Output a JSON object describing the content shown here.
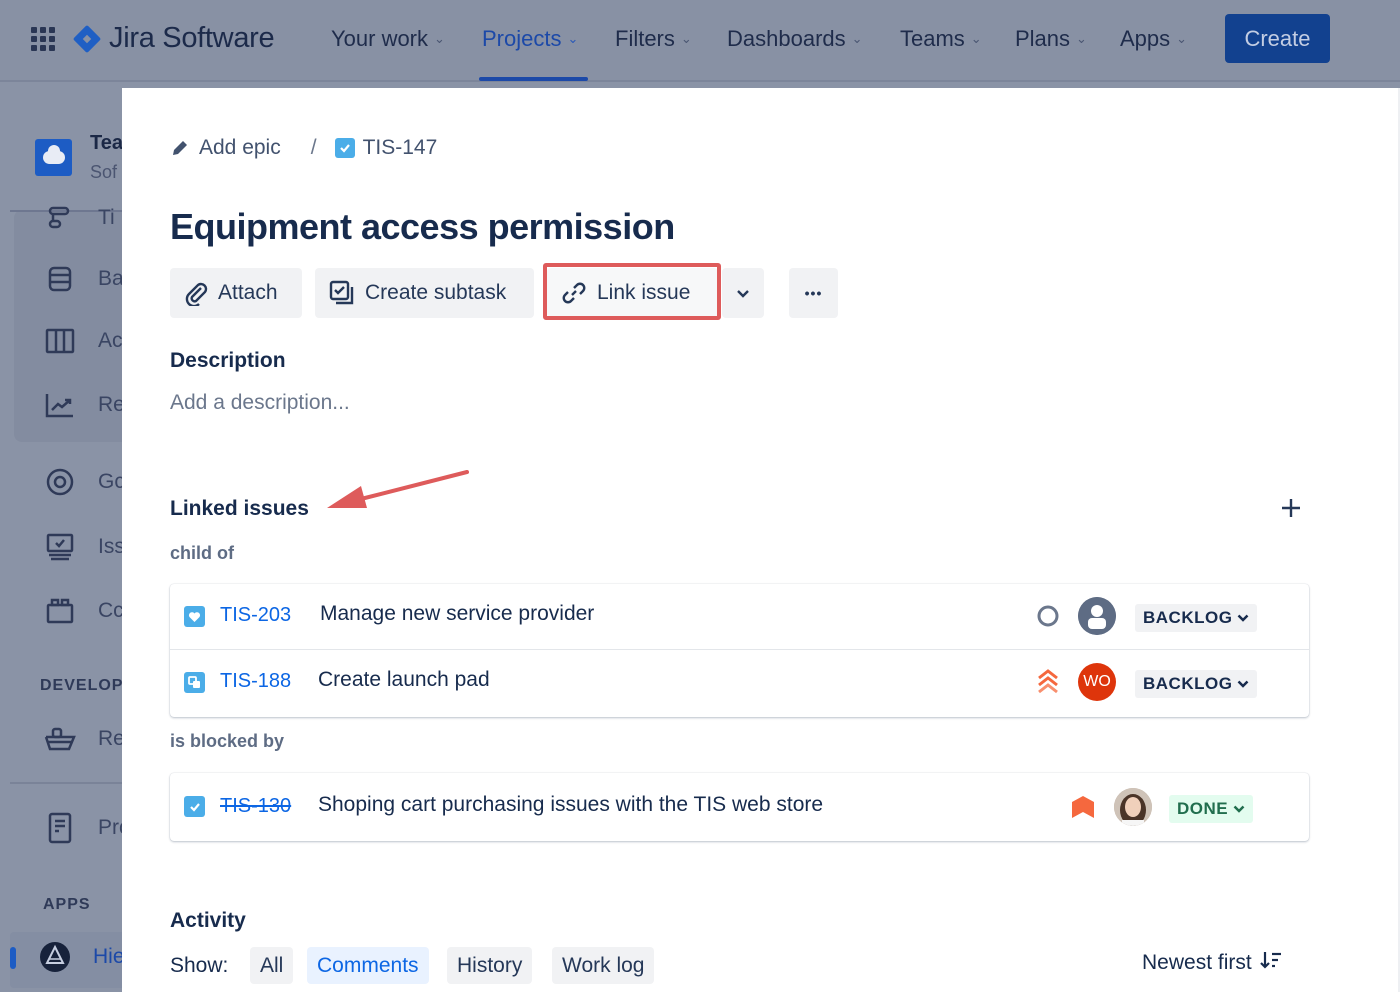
{
  "topnav": {
    "product_name": "Jira Software",
    "items": [
      {
        "label": "Your work",
        "active": false
      },
      {
        "label": "Projects",
        "active": true
      },
      {
        "label": "Filters",
        "active": false
      },
      {
        "label": "Dashboards",
        "active": false
      },
      {
        "label": "Teams",
        "active": false
      },
      {
        "label": "Plans",
        "active": false
      },
      {
        "label": "Apps",
        "active": false
      }
    ],
    "create_label": "Create",
    "chevron": "⌄"
  },
  "sidebar": {
    "project_name": "Tea",
    "project_type": "Sof",
    "items": [
      {
        "label": "Ti",
        "icon": "timeline-icon"
      },
      {
        "label": "Ba",
        "icon": "backlog-icon"
      },
      {
        "label": "Ac",
        "icon": "board-icon"
      },
      {
        "label": "Re",
        "icon": "reports-icon"
      },
      {
        "label": "Gc",
        "icon": "goals-icon"
      },
      {
        "label": "Iss",
        "icon": "issues-icon"
      },
      {
        "label": "Cc",
        "icon": "components-icon"
      }
    ],
    "develop_section": "DEVELOP",
    "develop_items": [
      {
        "label": "Re",
        "icon": "releases-icon"
      }
    ],
    "pages_item": {
      "label": "Pro",
      "icon": "pages-icon"
    },
    "apps_section": "APPS",
    "apps_items": [
      {
        "label": "Hie",
        "icon": "hierarchy-app-icon"
      }
    ]
  },
  "issue": {
    "breadcrumb": {
      "add_epic": "Add epic",
      "separator": "/",
      "key": "TIS-147"
    },
    "title": "Equipment access permission",
    "actions": {
      "attach": "Attach",
      "create_subtask": "Create subtask",
      "link_issue": "Link issue",
      "more_chevron": "⌄",
      "more": "•••"
    },
    "description": {
      "heading": "Description",
      "placeholder": "Add a description..."
    },
    "linked_issues": {
      "heading": "Linked issues",
      "add_icon": "+",
      "groups": [
        {
          "relation": "child of",
          "issues": [
            {
              "key": "TIS-203",
              "summary": "Manage new service provider",
              "type": "heart",
              "priority": "none",
              "assignee": "unassigned",
              "status": "BACKLOG",
              "done": false
            },
            {
              "key": "TIS-188",
              "summary": "Create launch pad",
              "type": "subtask",
              "priority": "highest",
              "assignee": "WO",
              "status": "BACKLOG",
              "done": false
            }
          ]
        },
        {
          "relation": "is blocked by",
          "issues": [
            {
              "key": "TIS-130",
              "summary": "Shoping cart purchasing issues with the TIS web store",
              "type": "task",
              "priority": "high",
              "assignee": "photo",
              "status": "DONE",
              "done": true
            }
          ]
        }
      ]
    },
    "activity": {
      "heading": "Activity",
      "show_label": "Show:",
      "filters": [
        {
          "label": "All",
          "active": false
        },
        {
          "label": "Comments",
          "active": true
        },
        {
          "label": "History",
          "active": false
        },
        {
          "label": "Work log",
          "active": false
        }
      ],
      "sort_label": "Newest first",
      "sort_icon": "↓="
    }
  },
  "colors": {
    "accent": "#0c66e4",
    "annotation_red": "#de5b5b",
    "overlay": "#8a93a6",
    "status_done_bg": "#e3fcef",
    "status_done_text": "#216e4e",
    "priority_orange": "#f5683e",
    "avatar_wo": "#de350b"
  }
}
